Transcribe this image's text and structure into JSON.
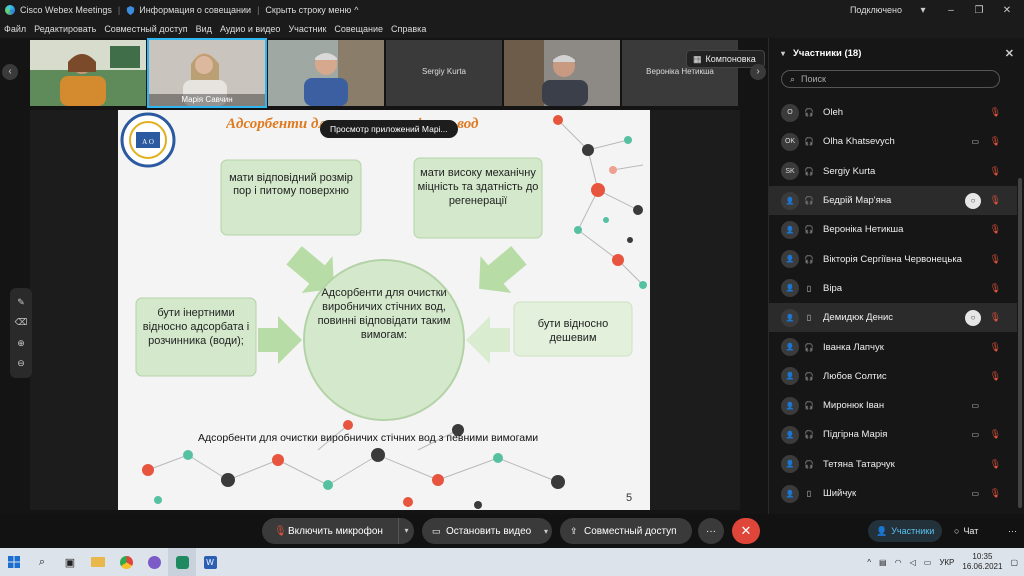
{
  "titlebar": {
    "app_name": "Cisco Webex Meetings",
    "meeting_info": "Информация о совещании",
    "hide_menu": "Скрыть строку меню",
    "status": "Подключено"
  },
  "menubar": [
    "Файл",
    "Редактировать",
    "Совместный доступ",
    "Вид",
    "Аудио и видео",
    "Участник",
    "Совещание",
    "Справка"
  ],
  "video_strip": {
    "tiles": [
      {
        "name": "",
        "camera": true
      },
      {
        "name": "Марія Савчин",
        "camera": true,
        "active": true
      },
      {
        "name": "",
        "camera": true
      },
      {
        "name": "Sergiy Kurta",
        "camera": false
      },
      {
        "name": "",
        "camera": true
      },
      {
        "name": "Вероніка Нетикша",
        "camera": false
      }
    ],
    "layout_button": "Компоновка"
  },
  "share_preview_label": "Просмотр приложений Марі...",
  "slide": {
    "title": "Адсорбенти для очистки стічних вод",
    "center": "Адсорбенти для очистки виробничих стічних вод, повинні відповідати таким вимогам:",
    "box_top_left": "мати відповідний розмір пор і питому поверхню",
    "box_top_right": "мати високу механічну міцність та здатність до регенерації",
    "box_left": "бути інертними відносно адсорбата і розчинника (води);",
    "box_right": "бути відносно дешевим",
    "caption": "Адсорбенти для очистки виробничих стічних вод з певними вимогами",
    "page_number": "5",
    "logo_text": "А О"
  },
  "participants": {
    "header": "Участники (18)",
    "search_placeholder": "Поиск",
    "list": [
      {
        "avatar": "O",
        "name": "Oleh",
        "device": "headset",
        "camera": false,
        "muted": true
      },
      {
        "avatar": "OK",
        "name": "Olha Khatsevych",
        "device": "headset",
        "camera": true,
        "muted": true
      },
      {
        "avatar": "SK",
        "name": "Sergiy Kurta",
        "device": "headset",
        "camera": false,
        "muted": true
      },
      {
        "avatar": "user",
        "name": "Бедрій Мар'яна",
        "device": "headset",
        "camera": false,
        "muted": true,
        "chat": true,
        "highlight": true
      },
      {
        "avatar": "user",
        "name": "Вероніка Нетикша",
        "device": "headset",
        "camera": false,
        "muted": true
      },
      {
        "avatar": "user",
        "name": "Вікторія Сергіївна Червонецька",
        "device": "headset",
        "camera": false,
        "muted": true
      },
      {
        "avatar": "user",
        "name": "Віра",
        "device": "phone",
        "camera": false,
        "muted": true
      },
      {
        "avatar": "user",
        "name": "Демидюк Денис",
        "device": "phone",
        "camera": false,
        "muted": true,
        "chat": true,
        "highlight": true
      },
      {
        "avatar": "user",
        "name": "Іванка Лапчук",
        "device": "headset",
        "camera": false,
        "muted": true
      },
      {
        "avatar": "user",
        "name": "Любов Солтис",
        "device": "headset",
        "camera": false,
        "muted": true
      },
      {
        "avatar": "user",
        "name": "Миронюк Іван",
        "device": "headset",
        "camera": true,
        "muted": false
      },
      {
        "avatar": "user",
        "name": "Підгірна Марія",
        "device": "headset",
        "camera": true,
        "muted": true
      },
      {
        "avatar": "user",
        "name": "Тетяна Татарчук",
        "device": "headset",
        "camera": false,
        "muted": true
      },
      {
        "avatar": "user",
        "name": "Шийчук",
        "device": "phone",
        "camera": true,
        "muted": true
      }
    ]
  },
  "controls": {
    "unmute": "Включить микрофон",
    "stop_video": "Остановить видео",
    "share": "Совместный доступ",
    "participants_tab": "Участники",
    "chat_tab": "Чат"
  },
  "taskbar": {
    "lang": "УКР",
    "time": "10:35",
    "date": "16.06.2021"
  },
  "colors": {
    "accent": "#2fb6f0",
    "end_call": "#e0453a",
    "muted": "#e0533b",
    "slide_box": "#d4e9cc",
    "slide_title": "#e07a1f"
  }
}
